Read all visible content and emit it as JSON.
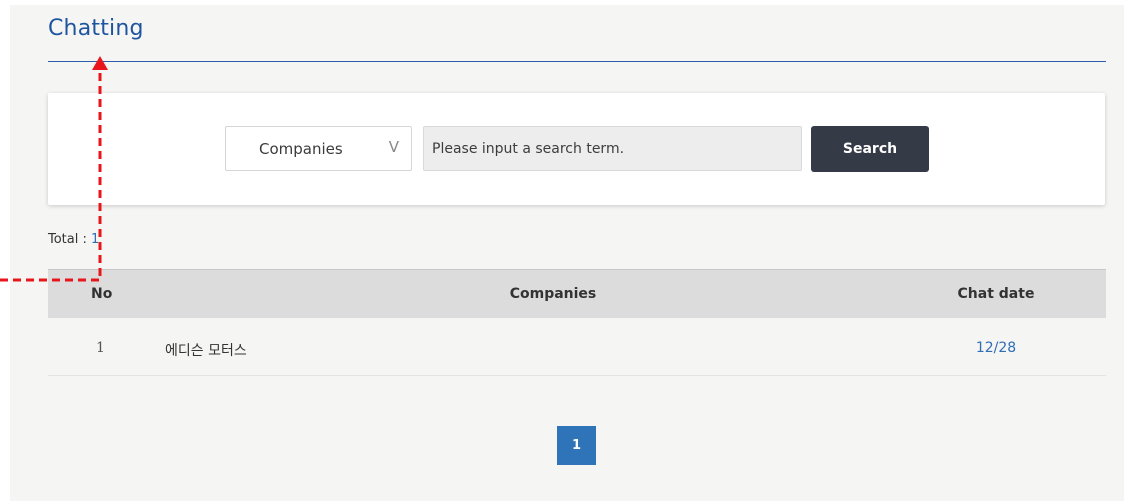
{
  "header": {
    "title": "Chatting"
  },
  "search": {
    "select_value": "Companies",
    "select_arrow_icon": "chevron-down-icon",
    "input_placeholder": "Please input a search term.",
    "input_value": "",
    "button_label": "Search"
  },
  "summary": {
    "total_label": "Total : ",
    "total_count": "1"
  },
  "table": {
    "columns": [
      "No",
      "Companies",
      "Chat date"
    ],
    "rows": [
      {
        "no": "1",
        "company": "에디슨 모터스",
        "chat_date": "12/28"
      }
    ]
  },
  "pagination": {
    "current_page": "1"
  },
  "colors": {
    "accent": "#1f55a0",
    "button_dark": "#343a46",
    "link": "#2f6db5",
    "annotation": "#e8161b"
  }
}
